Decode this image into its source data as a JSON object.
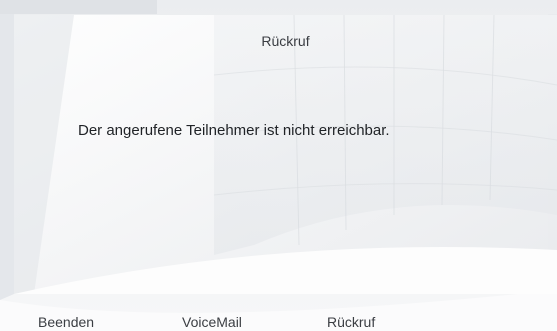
{
  "dialog": {
    "title": "Rückruf",
    "message": "Der angerufene Teilnehmer ist nicht erreichbar."
  },
  "softkeys": [
    {
      "label": "Beenden"
    },
    {
      "label": "VoiceMail"
    },
    {
      "label": "Rückruf"
    }
  ],
  "colors": {
    "text_primary": "#1f2226",
    "text_secondary": "#3a3d42",
    "panel": "#ffffff",
    "background": "#eceef1"
  }
}
